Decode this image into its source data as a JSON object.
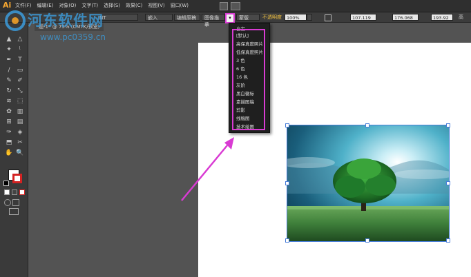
{
  "app": {
    "logo_text": "Ai"
  },
  "menu": {
    "items": [
      "文件(F)",
      "编辑(E)",
      "对象(O)",
      "文字(T)",
      "选择(S)",
      "效果(C)",
      "视图(V)",
      "窗口(W)"
    ]
  },
  "control_bar": {
    "segment_labels": [
      "NT",
      "嵌入",
      "编辑原稿",
      "图像描摹"
    ],
    "preset_value": "图像描摹",
    "preset_dropdown_glyph": "▾",
    "mask_label": "蒙版",
    "opacity_label": "不透明度",
    "opacity_value": "100%",
    "x_value": "107.119",
    "y_value": "176.068",
    "w_value": "193.92",
    "extra_label": "高"
  },
  "document": {
    "tab_label": "题-1* @ 75% (CMYK/预览)"
  },
  "preset_menu": {
    "header": "自定",
    "items": [
      "[默认]",
      "高保真度照片",
      "低保真度照片",
      "3 色",
      "6 色",
      "16 色",
      "灰阶",
      "黑白徽标",
      "素描图稿",
      "剪影",
      "线稿图",
      "技术绘图"
    ]
  },
  "watermark": {
    "title": "河东软件网",
    "url": "www.pc0359.cn"
  },
  "colors": {
    "accent_highlight": "#d93bd3",
    "selection": "#4a7ed9",
    "ui_dark": "#2f2f2f",
    "canvas_bg": "#535353"
  },
  "tools": {
    "icon_names": [
      "selection-tool-icon",
      "direct-selection-tool-icon",
      "magic-wand-icon",
      "lasso-icon",
      "pen-tool-icon",
      "type-tool-icon",
      "line-tool-icon",
      "rectangle-tool-icon",
      "paintbrush-icon",
      "pencil-icon",
      "rotate-tool-icon",
      "scale-tool-icon",
      "warp-tool-icon",
      "free-transform-icon",
      "symbol-sprayer-icon",
      "graph-tool-icon",
      "mesh-tool-icon",
      "gradient-tool-icon",
      "eyedropper-icon",
      "blend-tool-icon",
      "artboard-tool-icon",
      "slice-tool-icon",
      "hand-tool-icon",
      "zoom-tool-icon"
    ]
  }
}
